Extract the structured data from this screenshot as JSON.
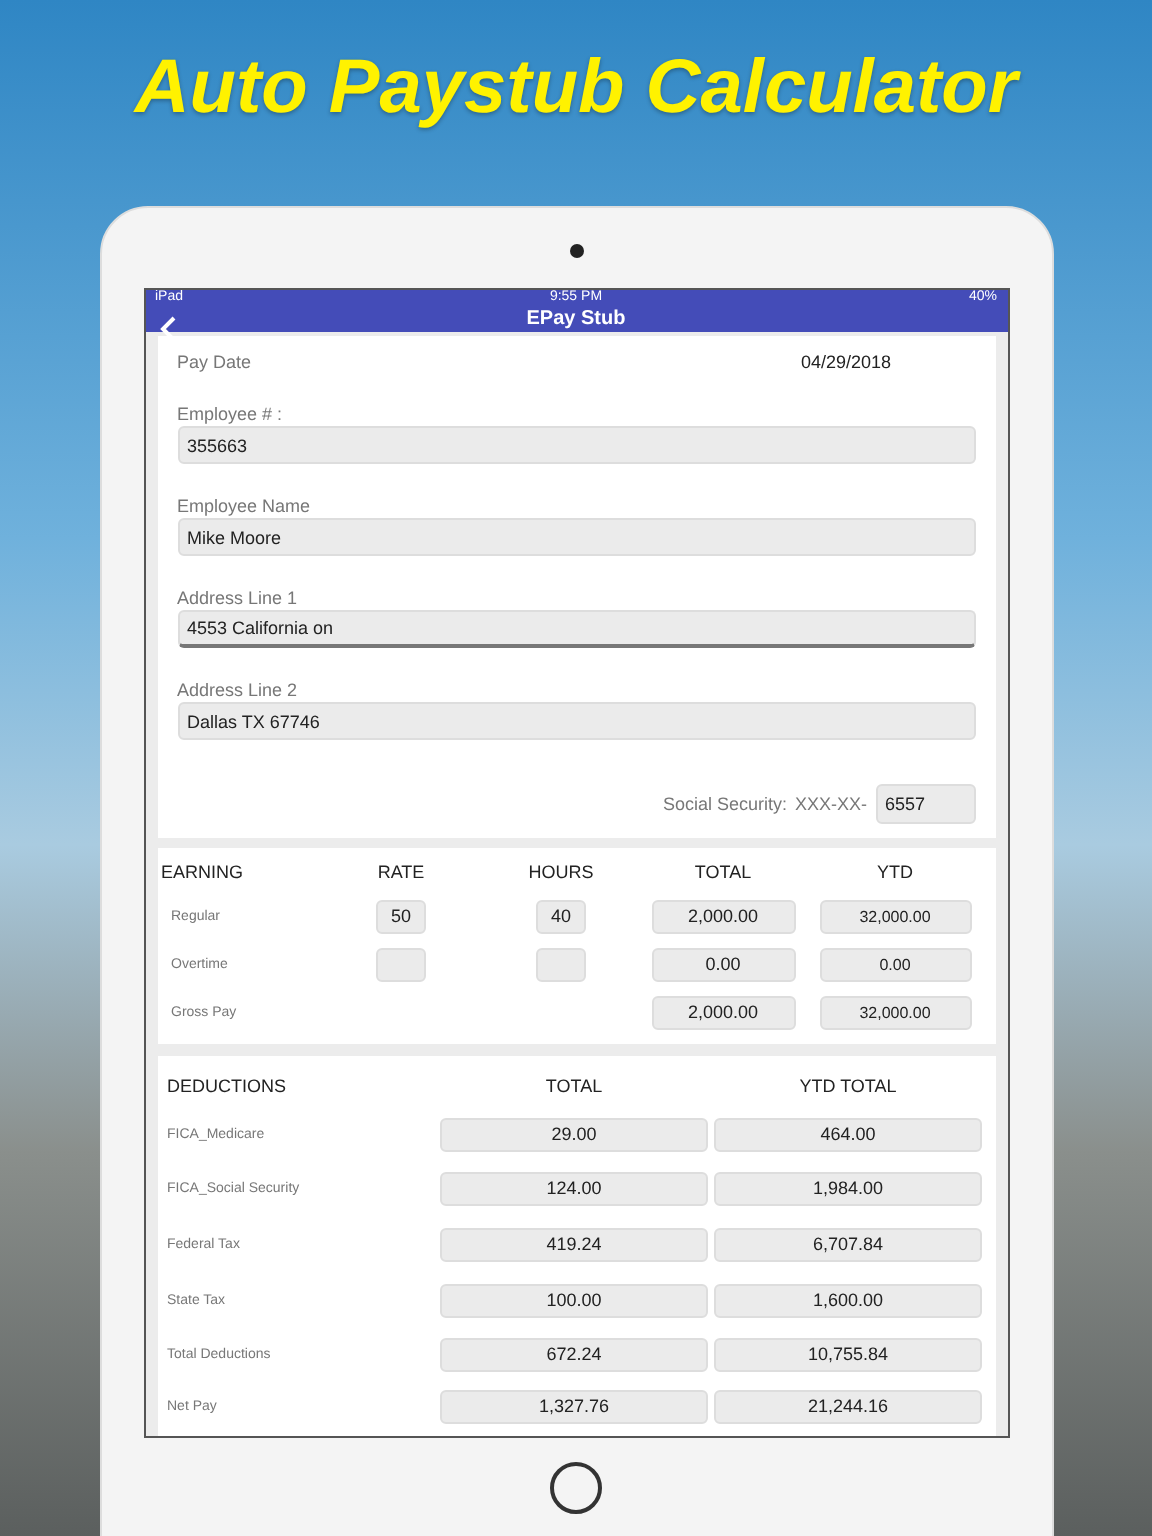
{
  "headline": "Auto Paystub Calculator",
  "status_bar": {
    "device": "iPad",
    "time": "9:55 PM",
    "battery": "40%"
  },
  "nav": {
    "title": "EPay Stub"
  },
  "pay_date": {
    "label": "Pay Date",
    "value": "04/29/2018"
  },
  "fields": [
    {
      "label": "Employee # :",
      "value": "355663",
      "focused": false
    },
    {
      "label": "Employee Name",
      "value": "Mike Moore",
      "focused": false
    },
    {
      "label": "Address Line 1",
      "value": "4553 California on",
      "focused": true
    },
    {
      "label": "Address Line 2",
      "value": "Dallas TX 67746",
      "focused": false
    }
  ],
  "social_security": {
    "label": "Social Security:",
    "prefix": "XXX-XX-",
    "value": "6557"
  },
  "earnings": {
    "columns": [
      "EARNING",
      "RATE",
      "HOURS",
      "TOTAL",
      "YTD"
    ],
    "rows": [
      {
        "kind": "entry",
        "label": "Regular",
        "rate": "50",
        "hours": "40",
        "total": "2,000.00",
        "ytd": "32,000.00"
      },
      {
        "kind": "entry",
        "label": "Overtime",
        "total": "0.00",
        "ytd": "0.00"
      },
      {
        "kind": "summary",
        "label": "Gross Pay",
        "total": "2,000.00",
        "ytd": "32,000.00"
      }
    ]
  },
  "deductions": {
    "columns": [
      "DEDUCTIONS",
      "TOTAL",
      "YTD TOTAL"
    ],
    "rows": [
      {
        "label": "FICA_Medicare",
        "total": "29.00",
        "ytd": "464.00"
      },
      {
        "label": "FICA_Social Security",
        "total": "124.00",
        "ytd": "1,984.00"
      },
      {
        "label": "Federal Tax",
        "total": "419.24",
        "ytd": "6,707.84"
      },
      {
        "label": "State Tax",
        "total": "100.00",
        "ytd": "1,600.00"
      },
      {
        "label": "Total Deductions",
        "total": "672.24",
        "ytd": "10,755.84"
      },
      {
        "label": "Net Pay",
        "total": "1,327.76",
        "ytd": "21,244.16"
      }
    ]
  }
}
